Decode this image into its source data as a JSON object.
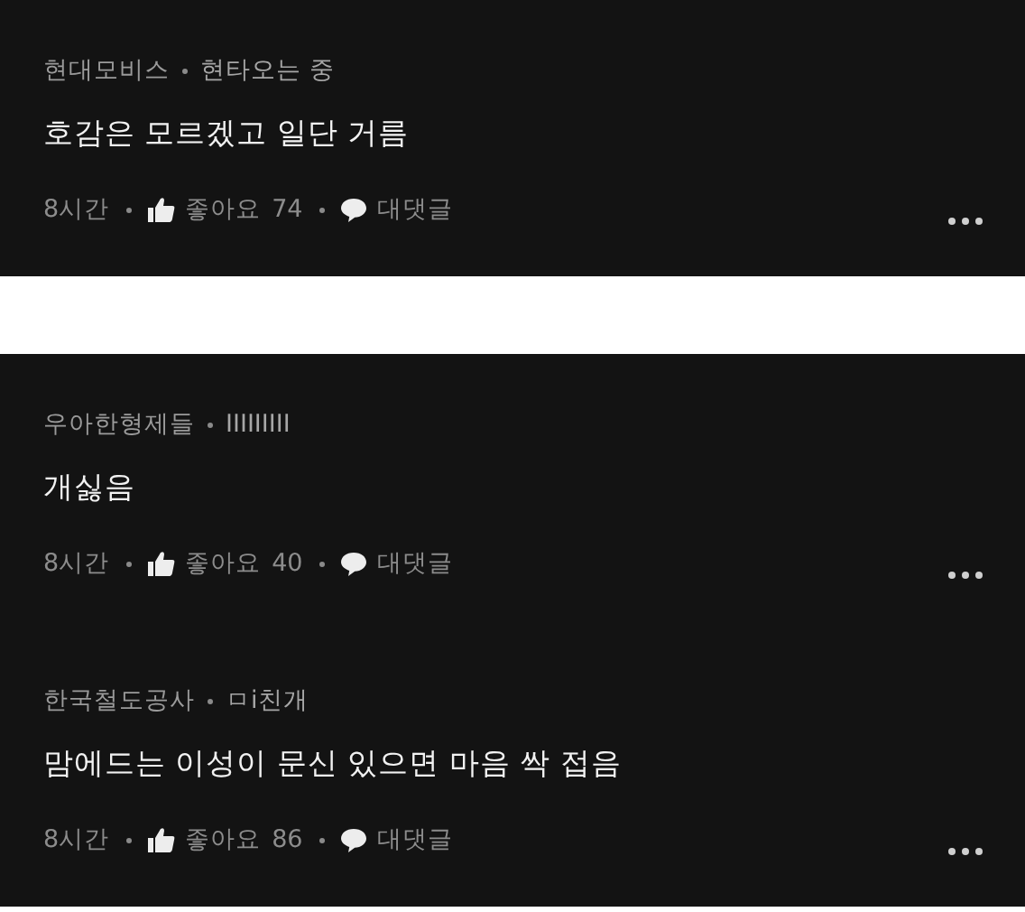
{
  "cards": [
    {
      "comments": [
        {
          "company": "현대모비스",
          "nickname": "현타오는 중",
          "text": "호감은 모르겠고 일단 거름",
          "time": "8시간",
          "like_label": "좋아요",
          "likes": "74",
          "reply": "대댓글"
        }
      ]
    },
    {
      "comments": [
        {
          "company": "우아한형제들",
          "nickname": "IIIIIIIII",
          "text": "개싫음",
          "time": "8시간",
          "like_label": "좋아요",
          "likes": "40",
          "reply": "대댓글"
        },
        {
          "company": "한국철도공사",
          "nickname": "ㅁi친개",
          "text": "맘에드는 이성이 문신 있으면 마음 싹 접음",
          "time": "8시간",
          "like_label": "좋아요",
          "likes": "86",
          "reply": "대댓글"
        }
      ]
    }
  ]
}
